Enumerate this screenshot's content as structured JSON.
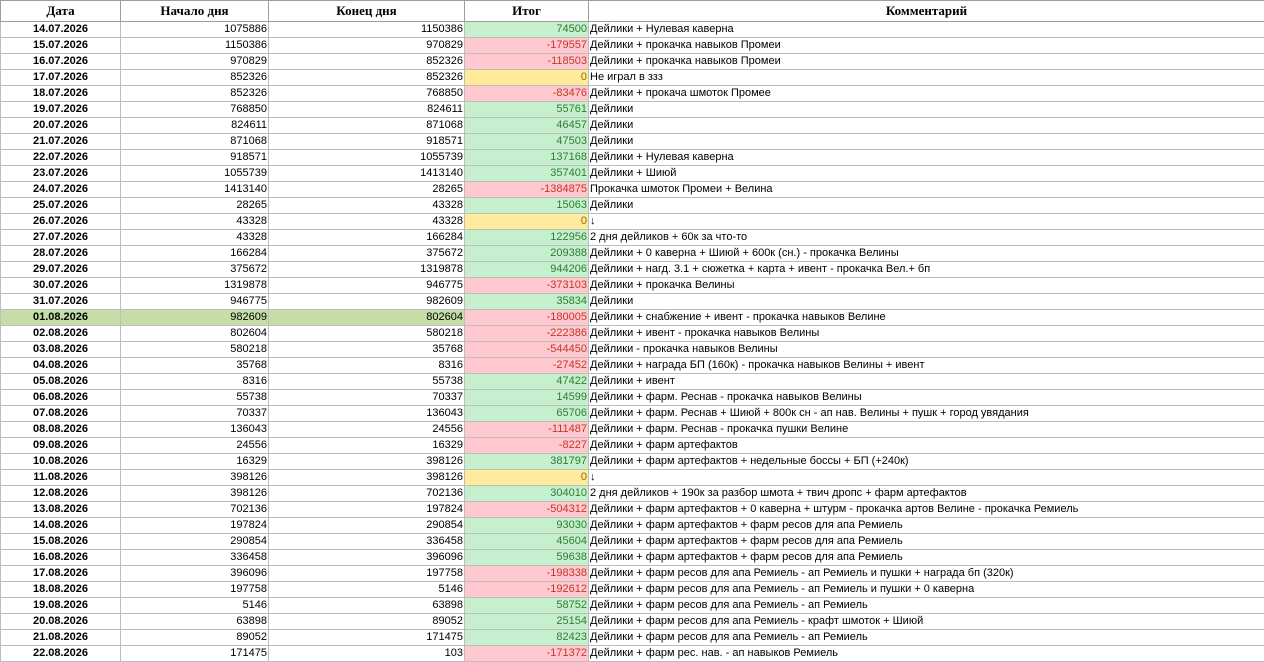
{
  "headers": {
    "date": "Дата",
    "start": "Начало дня",
    "end": "Конец дня",
    "result": "Итог",
    "comment": "Комментарий"
  },
  "colors": {
    "positive_fill": "#c6efce",
    "positive_text": "#2e7d32",
    "negative_fill": "#ffc7ce",
    "negative_text": "#c0392b",
    "zero_fill": "#ffeb9c",
    "zero_text": "#9c6500",
    "highlight_row": "#c5dea8"
  },
  "rows": [
    {
      "date": "14.07.2026",
      "start": "1075886",
      "end": "1150386",
      "result": "74500",
      "comment": "Дейлики + Нулевая каверна"
    },
    {
      "date": "15.07.2026",
      "start": "1150386",
      "end": "970829",
      "result": "-179557",
      "comment": "Дейлики + прокачка навыков Промеи"
    },
    {
      "date": "16.07.2026",
      "start": "970829",
      "end": "852326",
      "result": "-118503",
      "comment": "Дейлики + прокачка навыков Промеи"
    },
    {
      "date": "17.07.2026",
      "start": "852326",
      "end": "852326",
      "result": "0",
      "comment": "Не играл в ззз"
    },
    {
      "date": "18.07.2026",
      "start": "852326",
      "end": "768850",
      "result": "-83476",
      "comment": "Дейлики + прокача шмоток Промее"
    },
    {
      "date": "19.07.2026",
      "start": "768850",
      "end": "824611",
      "result": "55761",
      "comment": "Дейлики"
    },
    {
      "date": "20.07.2026",
      "start": "824611",
      "end": "871068",
      "result": "46457",
      "comment": "Дейлики"
    },
    {
      "date": "21.07.2026",
      "start": "871068",
      "end": "918571",
      "result": "47503",
      "comment": "Дейлики"
    },
    {
      "date": "22.07.2026",
      "start": "918571",
      "end": "1055739",
      "result": "137168",
      "comment": "Дейлики + Нулевая каверна"
    },
    {
      "date": "23.07.2026",
      "start": "1055739",
      "end": "1413140",
      "result": "357401",
      "comment": "Дейлики + Шиюй"
    },
    {
      "date": "24.07.2026",
      "start": "1413140",
      "end": "28265",
      "result": "-1384875",
      "comment": "Прокачка шмоток Промеи + Велина"
    },
    {
      "date": "25.07.2026",
      "start": "28265",
      "end": "43328",
      "result": "15063",
      "comment": "Дейлики"
    },
    {
      "date": "26.07.2026",
      "start": "43328",
      "end": "43328",
      "result": "0",
      "comment": "↓"
    },
    {
      "date": "27.07.2026",
      "start": "43328",
      "end": "166284",
      "result": "122956",
      "comment": "2 дня дейликов + 60к за что-то"
    },
    {
      "date": "28.07.2026",
      "start": "166284",
      "end": "375672",
      "result": "209388",
      "comment": "Дейлики + 0 каверна + Шиюй + 600к (сн.) - прокачка Велины"
    },
    {
      "date": "29.07.2026",
      "start": "375672",
      "end": "1319878",
      "result": "944206",
      "comment": "Дейлики + нагд. 3.1 + сюжетка + карта + ивент - прокачка Вел.+ бп"
    },
    {
      "date": "30.07.2026",
      "start": "1319878",
      "end": "946775",
      "result": "-373103",
      "comment": "Дейлики + прокачка Велины"
    },
    {
      "date": "31.07.2026",
      "start": "946775",
      "end": "982609",
      "result": "35834",
      "comment": "Дейлики"
    },
    {
      "date": "01.08.2026",
      "start": "982609",
      "end": "802604",
      "result": "-180005",
      "comment": "Дейлики + снабжение + ивент - прокачка навыков Велине",
      "highlight": true
    },
    {
      "date": "02.08.2026",
      "start": "802604",
      "end": "580218",
      "result": "-222386",
      "comment": "Дейлики + ивент - прокачка навыков Велины"
    },
    {
      "date": "03.08.2026",
      "start": "580218",
      "end": "35768",
      "result": "-544450",
      "comment": "Дейлики - прокачка навыков Велины"
    },
    {
      "date": "04.08.2026",
      "start": "35768",
      "end": "8316",
      "result": "-27452",
      "comment": "Дейлики + награда БП (160к) - прокачка навыков Велины + ивент"
    },
    {
      "date": "05.08.2026",
      "start": "8316",
      "end": "55738",
      "result": "47422",
      "comment": "Дейлики + ивент"
    },
    {
      "date": "06.08.2026",
      "start": "55738",
      "end": "70337",
      "result": "14599",
      "comment": "Дейлики + фарм. Реснав - прокачка навыков Велины"
    },
    {
      "date": "07.08.2026",
      "start": "70337",
      "end": "136043",
      "result": "65706",
      "comment": "Дейлики + фарм. Реснав + Шиюй + 800к сн - ап нав. Велины + пушк + город увядания"
    },
    {
      "date": "08.08.2026",
      "start": "136043",
      "end": "24556",
      "result": "-111487",
      "comment": "Дейлики + фарм. Реснав - прокачка пушки Велине"
    },
    {
      "date": "09.08.2026",
      "start": "24556",
      "end": "16329",
      "result": "-8227",
      "comment": "Дейлики + фарм артефактов"
    },
    {
      "date": "10.08.2026",
      "start": "16329",
      "end": "398126",
      "result": "381797",
      "comment": "Дейлики + фарм артефактов + недельные боссы + БП (+240к)"
    },
    {
      "date": "11.08.2026",
      "start": "398126",
      "end": "398126",
      "result": "0",
      "comment": "↓"
    },
    {
      "date": "12.08.2026",
      "start": "398126",
      "end": "702136",
      "result": "304010",
      "comment": "2 дня дейликов + 190к за разбор шмота + твич дропс + фарм артефактов"
    },
    {
      "date": "13.08.2026",
      "start": "702136",
      "end": "197824",
      "result": "-504312",
      "comment": "Дейлики + фарм артефактов + 0 каверна + штурм - прокачка артов Велине - прокачка Ремиель"
    },
    {
      "date": "14.08.2026",
      "start": "197824",
      "end": "290854",
      "result": "93030",
      "comment": "Дейлики + фарм артефактов + фарм ресов для апа Ремиель"
    },
    {
      "date": "15.08.2026",
      "start": "290854",
      "end": "336458",
      "result": "45604",
      "comment": "Дейлики + фарм артефактов + фарм ресов для апа Ремиель"
    },
    {
      "date": "16.08.2026",
      "start": "336458",
      "end": "396096",
      "result": "59638",
      "comment": "Дейлики + фарм артефактов + фарм ресов для апа Ремиель"
    },
    {
      "date": "17.08.2026",
      "start": "396096",
      "end": "197758",
      "result": "-198338",
      "comment": "Дейлики + фарм ресов для апа Ремиель - ап Ремиель и пушки + награда бп (320к)"
    },
    {
      "date": "18.08.2026",
      "start": "197758",
      "end": "5146",
      "result": "-192612",
      "comment": "Дейлики + фарм ресов для апа Ремиель - ап Ремиель и пушки + 0 каверна"
    },
    {
      "date": "19.08.2026",
      "start": "5146",
      "end": "63898",
      "result": "58752",
      "comment": "Дейлики + фарм ресов для апа Ремиель - ап Ремиель"
    },
    {
      "date": "20.08.2026",
      "start": "63898",
      "end": "89052",
      "result": "25154",
      "comment": "Дейлики + фарм ресов для апа Ремиель - крафт шмоток + Шиюй"
    },
    {
      "date": "21.08.2026",
      "start": "89052",
      "end": "171475",
      "result": "82423",
      "comment": "Дейлики + фарм ресов для апа Ремиель - ап Ремиель"
    },
    {
      "date": "22.08.2026",
      "start": "171475",
      "end": "103",
      "result": "-171372",
      "comment": "Дейлики + фарм рес. нав. - ап навыков Ремиель"
    }
  ]
}
